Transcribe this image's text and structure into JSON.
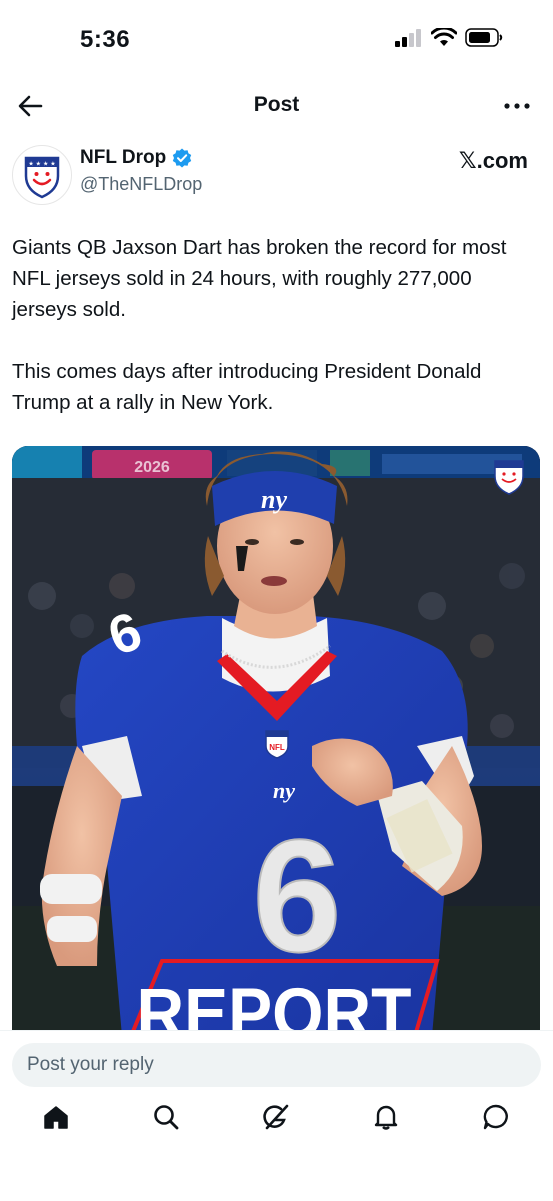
{
  "status_bar": {
    "time": "5:36"
  },
  "header": {
    "title": "Post"
  },
  "author": {
    "display_name": "NFL Drop",
    "handle": "@TheNFLDrop",
    "source_label": "𝕏.com"
  },
  "tweet": {
    "paragraphs": [
      "Giants QB Jaxson Dart has broken the record for most NFL jerseys sold in 24 hours, with roughly 277,000 jerseys sold.",
      "This comes days after introducing President Donald Trump at a rally in New York."
    ]
  },
  "media": {
    "banner_text": "REPORT",
    "helmet_logo": "ny",
    "chest_logo": "ny",
    "jersey_number": "6",
    "shield_text": "NFL",
    "stadium_sign_text": "2026"
  },
  "reply": {
    "placeholder": "Post your reply"
  },
  "tabbar": {
    "items": [
      {
        "icon": "home-icon",
        "active": true
      },
      {
        "icon": "search-icon"
      },
      {
        "icon": "grok-icon"
      },
      {
        "icon": "bell-icon"
      },
      {
        "icon": "messages-icon"
      }
    ]
  },
  "colors": {
    "accent": "#1d9bf0",
    "giants_blue": "#1f3fae",
    "report_red": "#e41b23"
  }
}
